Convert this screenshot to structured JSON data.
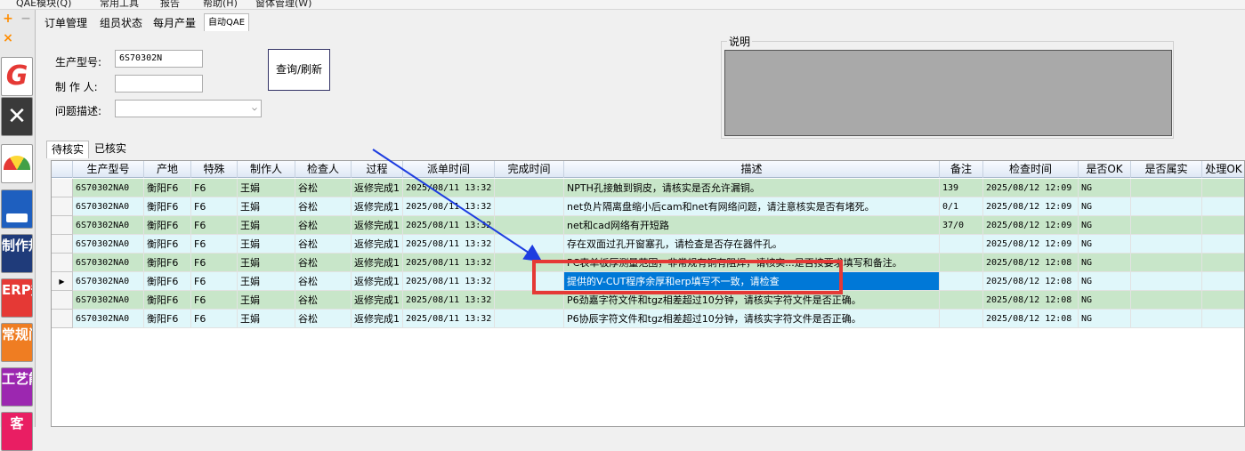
{
  "menubar": {
    "items": [
      "QAE模块(Q)",
      "常用工具",
      "报告",
      "帮助(H)",
      "窗体管理(W)"
    ]
  },
  "sidebar": {
    "sys_buttons": [
      "+",
      "−",
      "×"
    ],
    "icons": [
      {
        "name": "logo-g-icon",
        "text": "G",
        "bg": "#ffffff",
        "color": "#e53935"
      },
      {
        "name": "tools-icon",
        "text": "",
        "bg": "#3a3a3a"
      },
      {
        "name": "gauge-icon",
        "text": "",
        "bg": "#ffffff"
      },
      {
        "name": "save-disk-icon",
        "text": "",
        "bg": "#1e5fbf"
      },
      {
        "name": "sidebar-item-production-spec",
        "text": "制作规范",
        "bg": "#1f3b7a"
      },
      {
        "name": "sidebar-item-erp-spec",
        "text": "ERP规范",
        "bg": "#e53935"
      },
      {
        "name": "sidebar-item-common-issues",
        "text": "常规问题",
        "bg": "#ef7d22"
      },
      {
        "name": "sidebar-item-process-capability",
        "text": "工艺能力",
        "bg": "#9c27b0"
      },
      {
        "name": "sidebar-item-extra",
        "text": "客",
        "bg": "#e91e63"
      }
    ]
  },
  "tabs": [
    "订单管理",
    "组员状态",
    "每月产量",
    "自动QAE"
  ],
  "form": {
    "model_label": "生产型号:",
    "model_value": "6S70302N",
    "maker_label": "制 作 人:",
    "maker_value": "",
    "issue_label": "问题描述:",
    "issue_value": "",
    "query_button": "查询/刷新",
    "desc_label": "说明"
  },
  "subtabs": [
    "待核实",
    "已核实"
  ],
  "grid": {
    "columns": [
      "生产型号",
      "产地",
      "特殊",
      "制作人",
      "检查人",
      "过程",
      "派单时间",
      "完成时间",
      "描述",
      "备注",
      "检查时间",
      "是否OK",
      "是否属实",
      "处理OK"
    ],
    "rows": [
      {
        "cells": [
          "6S70302NA0",
          "衡阳F6",
          "F6",
          "王娟",
          "谷松",
          "返修完成1",
          "2025/08/11 13:32",
          "",
          "NPTH孔接触到铜皮，请核实是否允许漏铜。",
          "139",
          "2025/08/12 12:09",
          "NG",
          "",
          ""
        ],
        "bg": "g",
        "indicator": ""
      },
      {
        "cells": [
          "6S70302NA0",
          "衡阳F6",
          "F6",
          "王娟",
          "谷松",
          "返修完成1",
          "2025/08/11 13:32",
          "",
          "net负片隔离盘缩小后cam和net有网络问题，请注意核实是否有堵死。",
          "0/1",
          "2025/08/12 12:09",
          "NG",
          "",
          ""
        ],
        "bg": "c",
        "indicator": ""
      },
      {
        "cells": [
          "6S70302NA0",
          "衡阳F6",
          "F6",
          "王娟",
          "谷松",
          "返修完成1",
          "2025/08/11 13:32",
          "",
          "net和cad网络有开短路",
          "37/0",
          "2025/08/12 12:09",
          "NG",
          "",
          ""
        ],
        "bg": "g",
        "indicator": ""
      },
      {
        "cells": [
          "6S70302NA0",
          "衡阳F6",
          "F6",
          "王娟",
          "谷松",
          "返修完成1",
          "2025/08/11 13:32",
          "",
          "存在双面过孔开窗塞孔，请检查是否存在器件孔。",
          "",
          "2025/08/12 12:09",
          "NG",
          "",
          ""
        ],
        "bg": "c",
        "indicator": ""
      },
      {
        "cells": [
          "6S70302NA0",
          "衡阳F6",
          "F6",
          "王娟",
          "谷松",
          "返修完成1",
          "2025/08/11 13:32",
          "",
          "PC表单板厚测量范围，非常规有铜有阻焊，请核实...是否按要求填写和备注。",
          "",
          "2025/08/12 12:08",
          "NG",
          "",
          ""
        ],
        "bg": "g",
        "indicator": ""
      },
      {
        "cells": [
          "6S70302NA0",
          "衡阳F6",
          "F6",
          "王娟",
          "谷松",
          "返修完成1",
          "2025/08/11 13:32",
          "",
          "提供的V-CUT程序余厚和erp填写不一致，请检查",
          "",
          "2025/08/12 12:08",
          "NG",
          "",
          ""
        ],
        "bg": "c",
        "indicator": "▶",
        "selected_col": 8
      },
      {
        "cells": [
          "6S70302NA0",
          "衡阳F6",
          "F6",
          "王娟",
          "谷松",
          "返修完成1",
          "2025/08/11 13:32",
          "",
          "P6劲嘉字符文件和tgz相差超过10分钟，请核实字符文件是否正确。",
          "",
          "2025/08/12 12:08",
          "NG",
          "",
          ""
        ],
        "bg": "g",
        "indicator": ""
      },
      {
        "cells": [
          "6S70302NA0",
          "衡阳F6",
          "F6",
          "王娟",
          "谷松",
          "返修完成1",
          "2025/08/11 13:32",
          "",
          "P6协辰字符文件和tgz相差超过10分钟，请核实字符文件是否正确。",
          "",
          "2025/08/12 12:08",
          "NG",
          "",
          ""
        ],
        "bg": "c",
        "indicator": ""
      }
    ]
  },
  "colors": {
    "selection": "#0078d7",
    "highlight_box": "#e53935",
    "arrow": "#1e3de0"
  }
}
